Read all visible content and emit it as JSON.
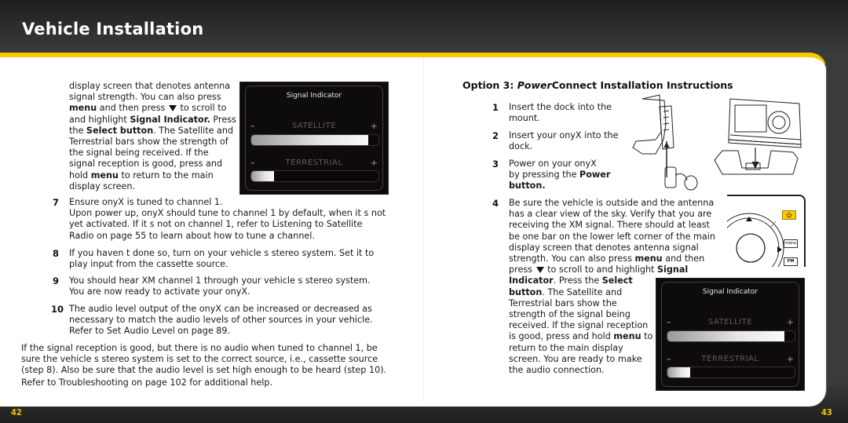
{
  "header": {
    "title": "Vehicle Installation"
  },
  "left_page": {
    "intro_lines": [
      "display screen that denotes antenna",
      "signal strength. You can also press",
      "and highlight",
      "the",
      "Terrestrial bars show the strength of",
      "the signal being received. If the",
      "signal reception is good, press and",
      "hold",
      "display screen."
    ],
    "intro": {
      "line3_bold": "menu",
      "line3_rest": " and then press ",
      "line3_end": " to scroll to",
      "line4_start": "and highlight ",
      "line4_bold": "Signal Indicator.",
      "line4_end": " Press",
      "line5_start": "the ",
      "line5_bold": "Select button",
      "line5_end": ". The Satellite and",
      "line9_bold": "menu",
      "line9_end": " to return to the main"
    },
    "steps": [
      {
        "num": "7",
        "lines": [
          "Ensure onyX is tuned to channel 1.",
          "Upon power up, onyX should tune to channel 1 by default, when it s not",
          "yet activated. If it s not on channel 1, refer to   Listening to Satellite",
          "Radio   on page 55 to learn about how to tune a channel."
        ]
      },
      {
        "num": "8",
        "lines": [
          "If you haven t done so, turn on your vehicle s stereo system.  Set it to",
          "play input from the cassette source."
        ]
      },
      {
        "num": "9",
        "lines": [
          "You should hear XM channel 1 through your vehicle s stereo system.",
          "You are now ready to activate your onyX."
        ]
      },
      {
        "num": "10",
        "lines": [
          "The audio level output of the onyX can be increased or decreased as",
          "necessary to match the audio levels of other sources in your vehicle.",
          "Refer to   Set Audio Level   on page 89."
        ]
      }
    ],
    "footer_lines": [
      "If the signal reception is good, but there is no audio when tuned to channel 1, be",
      "sure the vehicle s stereo system is set to the correct source, i.e., cassette source",
      "(step 8). Also be sure that the audio level is set high enough to be heard (step 10).",
      "Refer to   Troubleshooting   on page 102 for additional help."
    ],
    "page_number": "42"
  },
  "signal_indicator": {
    "title": "Signal Indicator",
    "satellite_label": "SATELLITE",
    "terrestrial_label": "TERRESTRIAL",
    "minus": "–",
    "plus": "+",
    "satellite_level_pct": 92,
    "terrestrial_level_pct": 18
  },
  "right_page": {
    "heading_prefix": "Option 3: ",
    "heading_italic": "Power",
    "heading_rest": "Connect Installation Instructions",
    "steps": [
      {
        "num": "1",
        "lines": [
          "Insert the dock into the",
          "mount."
        ]
      },
      {
        "num": "2",
        "lines": [
          "Insert your onyX into the",
          "dock."
        ]
      },
      {
        "num": "3",
        "lines": [
          "Power on your onyX",
          "by pressing the ",
          "button."
        ],
        "bold": "Power"
      }
    ],
    "step4": {
      "num": "4",
      "lines": [
        "Be sure the vehicle is outside and the antenna",
        "has a clear view of the sky. Verify that you are",
        "receiving the XM signal. There should at least",
        "be one bar on the lower left corner of the main",
        "display screen that denotes antenna signal",
        "strength. You can also press "
      ],
      "menu": "menu",
      "and_then": " and then",
      "press": "press ",
      "scroll": " to scroll to and highlight ",
      "signal": "Signal",
      "indicator": "Indicator",
      "press_the": ". Press the ",
      "select": "Select",
      "button": "button",
      "rest1": ". The Satellite and",
      "lines2": [
        "Terrestrial bars show the",
        "strength of the signal being",
        "received. If the signal reception",
        "is good, press and hold "
      ],
      "menu2": "menu",
      "to": " to",
      "lines3": [
        "return to the main display",
        "screen. You are ready to make",
        "the audio connection."
      ]
    },
    "device_buttons": {
      "menu": "menu",
      "fm": "FM"
    },
    "page_number": "43"
  }
}
